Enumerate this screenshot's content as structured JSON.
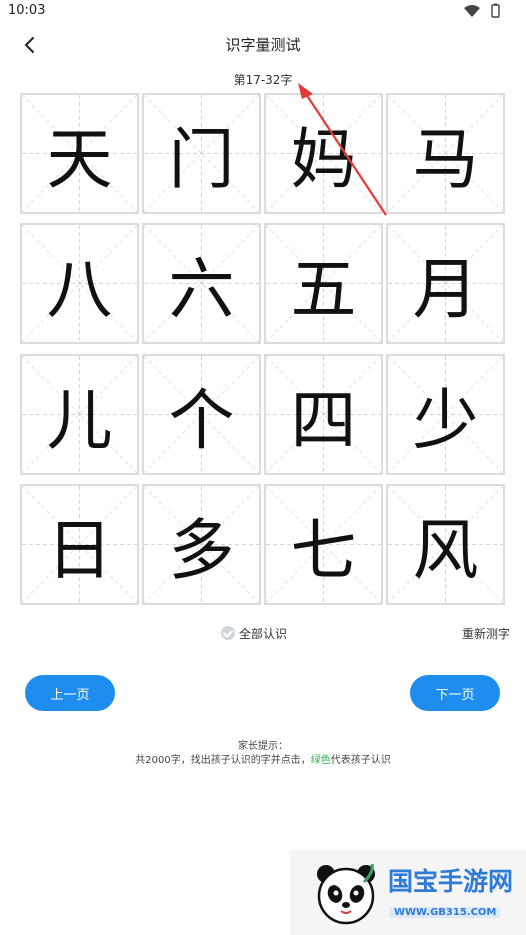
{
  "status_bar": {
    "time": "10:03"
  },
  "header": {
    "title": "识字量测试",
    "range": "第17-32字"
  },
  "characters": [
    "天",
    "门",
    "妈",
    "马",
    "八",
    "六",
    "五",
    "月",
    "儿",
    "个",
    "四",
    "少",
    "日",
    "多",
    "七",
    "风"
  ],
  "actions": {
    "check_all": "全部认识",
    "retest": "重新测字",
    "prev": "上一页",
    "next": "下一页"
  },
  "tips": {
    "title": "家长提示：",
    "line_before": "共2000字，找出孩子认识的字并点击，",
    "line_green": "绿色",
    "line_after": "代表孩子认识"
  },
  "watermark": {
    "title": "国宝手游网",
    "url": "WWW.GB315.COM"
  },
  "colors": {
    "primary": "#1f8cf0",
    "arrow": "#e53935",
    "green": "#28b24b",
    "grid_border": "#dcdcdc"
  },
  "icons": {
    "back": "chevron-left-icon",
    "wifi": "wifi-icon",
    "battery": "battery-icon",
    "check": "check-circle-icon"
  }
}
